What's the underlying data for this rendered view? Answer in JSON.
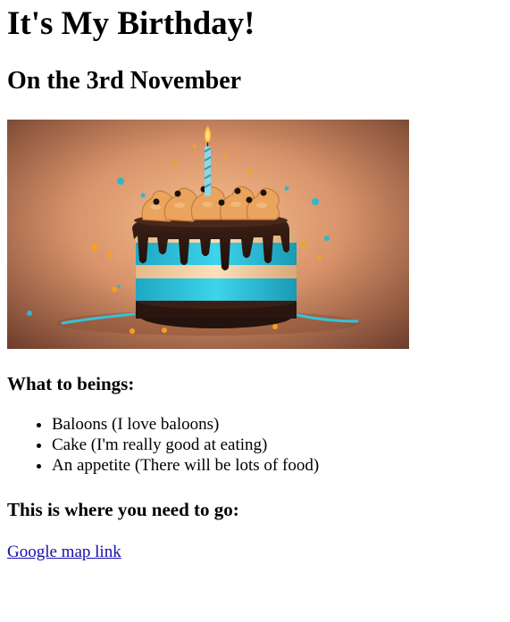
{
  "page": {
    "title": "It's My Birthday!",
    "subtitle": "On the 3rd November",
    "what_heading": "What to beings:",
    "bring_items": [
      "Baloons (I love baloons)",
      "Cake (I'm really good at eating)",
      "An appetite (There will be lots of food)"
    ],
    "where_heading": "This is where you need to go:",
    "map_link_text": "Google map link"
  },
  "colors": {
    "link": "#1a0dab",
    "cake_teal": "#2ec4dc",
    "cake_cream": "#f2d2a6",
    "chocolate": "#2a1610",
    "background_warm": "#b9754f"
  },
  "image": {
    "subject": "birthday-cake-with-candle-illustration"
  }
}
